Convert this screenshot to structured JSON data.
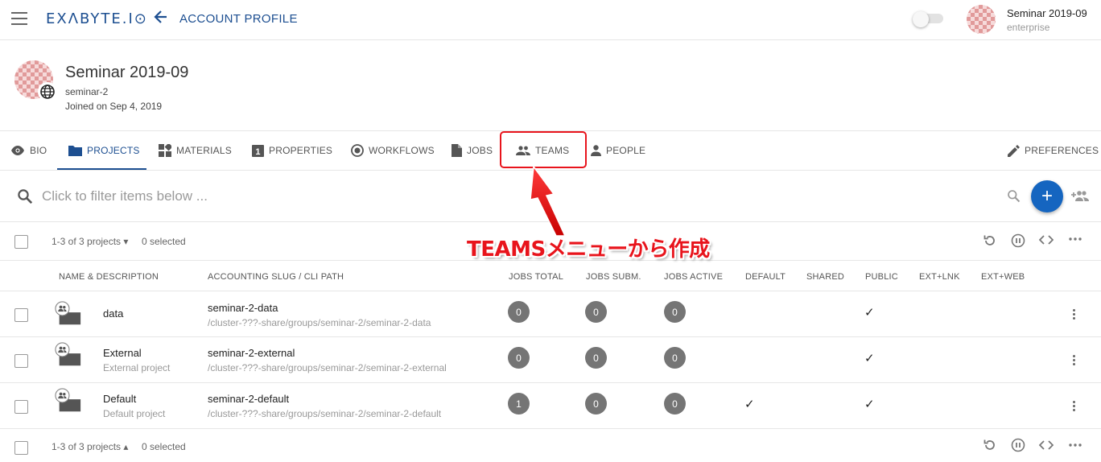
{
  "topbar": {
    "logo": "EXΛBYTE.I⊙",
    "title": "ACCOUNT PROFILE",
    "user_name": "Seminar 2019-09",
    "user_plan": "enterprise"
  },
  "profile": {
    "name": "Seminar 2019-09",
    "slug": "seminar-2",
    "joined": "Joined on Sep 4, 2019"
  },
  "tabs": [
    {
      "label": "BIO",
      "icon": "eye-icon"
    },
    {
      "label": "PROJECTS",
      "icon": "folder-icon",
      "active": true
    },
    {
      "label": "MATERIALS",
      "icon": "materials-icon"
    },
    {
      "label": "PROPERTIES",
      "icon": "properties-icon"
    },
    {
      "label": "WORKFLOWS",
      "icon": "workflow-icon"
    },
    {
      "label": "JOBS",
      "icon": "file-icon"
    },
    {
      "label": "TEAMS",
      "icon": "people-icon"
    },
    {
      "label": "PEOPLE",
      "icon": "person-icon"
    },
    {
      "label": "PREFERENCES",
      "icon": "pencil-icon"
    }
  ],
  "filter": {
    "placeholder": "Click to filter items below ..."
  },
  "toolbar": {
    "count": "1-3 of 3 projects",
    "selected": "0 selected"
  },
  "annotation": "TEAMSメニューから作成",
  "columns": {
    "name": "NAME & DESCRIPTION",
    "slug": "ACCOUNTING SLUG / CLI PATH",
    "jobs_total": "JOBS TOTAL",
    "jobs_subm": "JOBS SUBM.",
    "jobs_active": "JOBS ACTIVE",
    "default": "DEFAULT",
    "shared": "SHARED",
    "public": "PUBLIC",
    "ext_lnk": "EXT+LNK",
    "ext_web": "EXT+WEB"
  },
  "rows": [
    {
      "name": "data",
      "description": "",
      "slug": "seminar-2-data",
      "path": "/cluster-???-share/groups/seminar-2/seminar-2-data",
      "jobs_total": "0",
      "jobs_subm": "0",
      "jobs_active": "0",
      "default": false,
      "public": true
    },
    {
      "name": "External",
      "description": "External project",
      "slug": "seminar-2-external",
      "path": "/cluster-???-share/groups/seminar-2/seminar-2-external",
      "jobs_total": "0",
      "jobs_subm": "0",
      "jobs_active": "0",
      "default": false,
      "public": true
    },
    {
      "name": "Default",
      "description": "Default project",
      "slug": "seminar-2-default",
      "path": "/cluster-???-share/groups/seminar-2/seminar-2-default",
      "jobs_total": "1",
      "jobs_subm": "0",
      "jobs_active": "0",
      "default": true,
      "public": true
    }
  ],
  "colors": {
    "brand": "#1d4f91",
    "fab": "#1565c0",
    "annotation": "#e8141c",
    "badge": "#757575"
  }
}
